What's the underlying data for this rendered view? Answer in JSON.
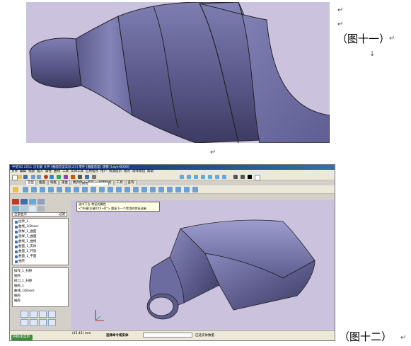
{
  "captions": {
    "fig11": "（图十一）",
    "fig12": "（图十二）"
  },
  "paragraph_mark": "↵",
  "arrow_mark": "↓",
  "app": {
    "title": "中望3D 2011 汉化版    文件 [曲面造型实验.Z3]   零件 [曲面造型] 建模 [Layer0000]",
    "menu": [
      "文件",
      "编辑",
      "视图",
      "插入",
      "属性",
      "曲线",
      "工具",
      "实体工具",
      "应用程序",
      "用户",
      "快速提示",
      "视点",
      "动作按钮",
      "帮助"
    ],
    "tabs": [
      "造型",
      "曲面",
      "线框",
      "钣金",
      "模具体",
      "点云",
      "视图样式",
      "工具",
      "查询"
    ],
    "active_tab": "造型",
    "view_combo": "所有",
    "search_text": "全部显示",
    "search_button": "过滤",
    "tree_items": [
      "拉伸_1",
      "曲线_1(Base)",
      "放样_1_曲面",
      "放样_1_曲面",
      "曲线_1_曲线",
      "曲面_1_实体",
      "曲面_1_开放",
      "曲面_1_平面",
      "抽壳"
    ],
    "command_items": [
      "操作_1_扫掠",
      "抽壳",
      "接口_1_扫掠",
      "抽壳_1",
      "曲线_1(Base)",
      "抽壳",
      "抽壳"
    ],
    "tooltip_line1": "选中下方 特征的属性",
    "tooltip_line2": "<\"中键/左键/Ctrl+D\"> 重复下一个常用的特征或者",
    "status_coords": "(45.45) mm",
    "status_prompt": "选择命令或实体",
    "status_hint": "已选实体数量",
    "start_button": "开始/主菜单"
  },
  "colors": {
    "background_3d": "#cbc2dd",
    "surface_dark": "#4c4a75",
    "surface_mid": "#6d6ca0",
    "surface_light": "#9c9ccb"
  }
}
